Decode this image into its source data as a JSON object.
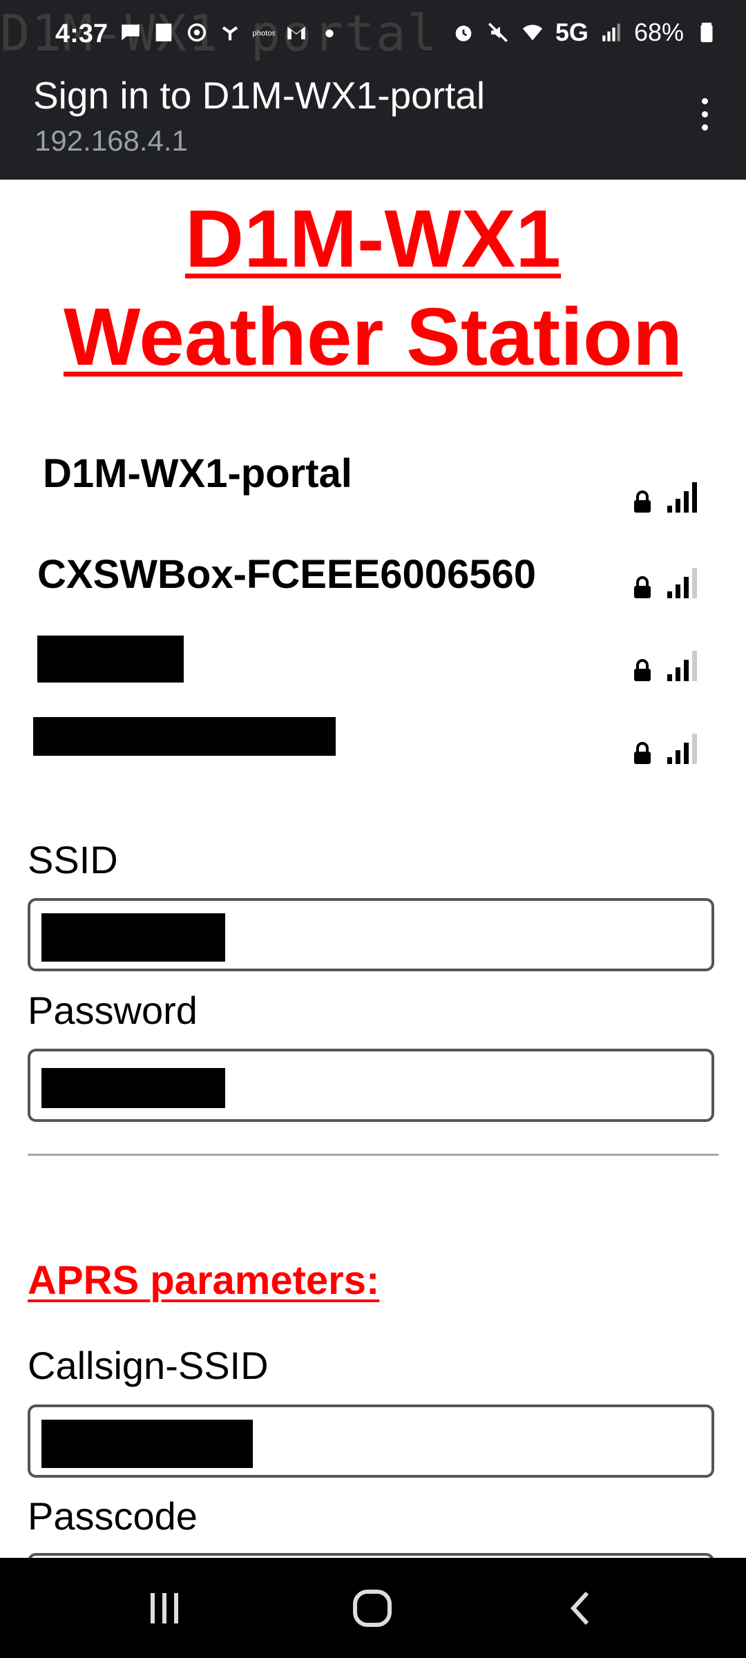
{
  "status_bar": {
    "ghost_text": "D1M-WX1 portal",
    "time": "4:37",
    "network": "5G",
    "battery": "68%"
  },
  "header": {
    "title": "Sign in to D1M-WX1-portal",
    "url": "192.168.4.1"
  },
  "page": {
    "title_line1": "D1M-WX1",
    "title_line2": "Weather Station",
    "networks": [
      {
        "name": "D1M-WX1-portal",
        "signal": 4
      },
      {
        "name": "CXSWBox-FCEEE6006560",
        "signal": 3
      },
      {
        "name": "",
        "signal": 3
      },
      {
        "name": "",
        "signal": 3
      }
    ],
    "ssid_label": "SSID",
    "password_label": "Password",
    "aprs_heading": "APRS parameters:",
    "callsign_label": "Callsign-SSID",
    "passcode_label": "Passcode"
  },
  "colors": {
    "accent": "#ff0000",
    "bar_bg": "#202124"
  },
  "icons": {
    "nav": [
      "recent-apps-icon",
      "home-icon",
      "back-icon"
    ]
  }
}
